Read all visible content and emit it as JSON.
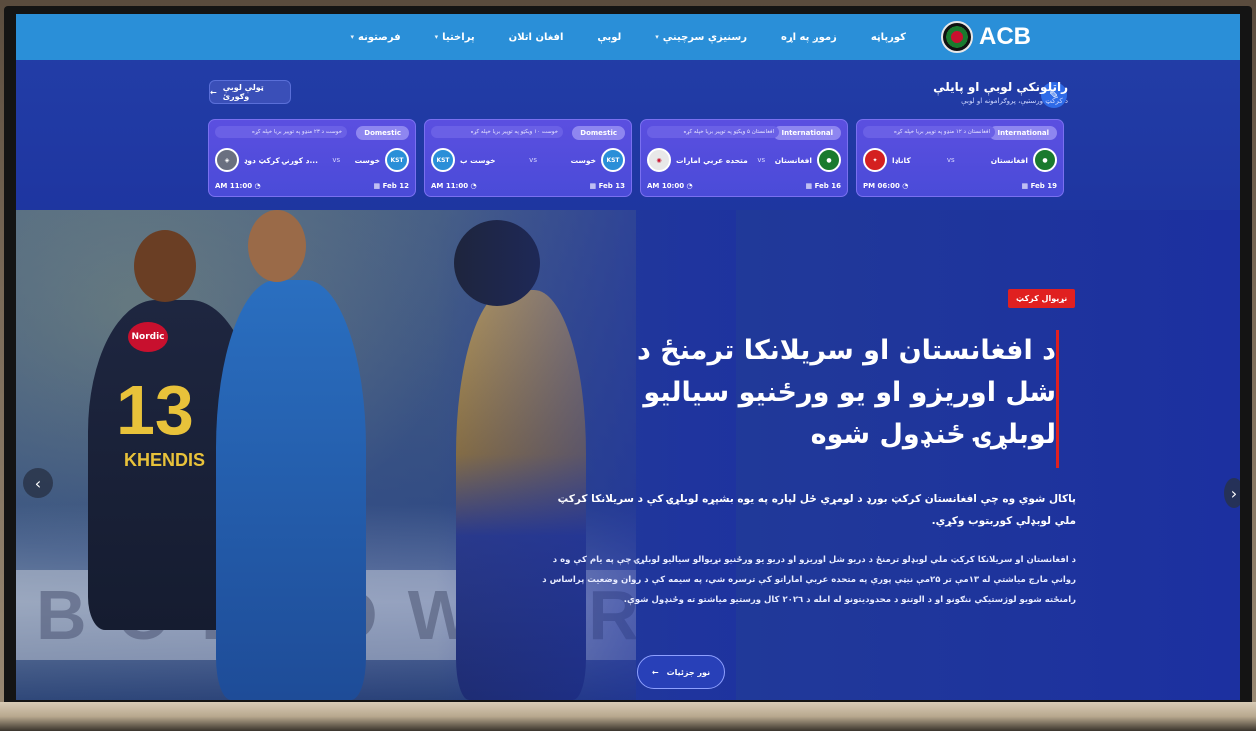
{
  "brand": {
    "name": "ACB"
  },
  "nav": {
    "items": [
      {
        "label": "کورپاڼه",
        "has_dropdown": false
      },
      {
        "label": "زموږ په اړه",
        "has_dropdown": false
      },
      {
        "label": "رسنیزې سرچینې",
        "has_dropdown": true
      },
      {
        "label": "لوبې",
        "has_dropdown": false
      },
      {
        "label": "افغان اتلان",
        "has_dropdown": false
      },
      {
        "label": "پراختیا",
        "has_dropdown": true
      },
      {
        "label": "فرصتونه",
        "has_dropdown": true
      }
    ]
  },
  "live": {
    "title": "راتلونکې لوبې او پایلې",
    "subtitle": "د کرکټ ورستیې، پروګرامونه او لوبې",
    "all_matches_label": "ټولې لوبې وګورئ"
  },
  "matches": [
    {
      "type": "International",
      "note": "افغانستان د ۱۲ منډو په توپیر بریا خپله کړه",
      "team_a": "افغانستان",
      "team_b": "کاناډا",
      "vs": "vs",
      "date": "Feb 19",
      "time": "PM 06:00",
      "team_a_color": "#1a7a2e",
      "team_b_color": "#d42020"
    },
    {
      "type": "International",
      "note": "افغانستان ۵ ویکټو په توپیر بریا خپله کړه",
      "team_a": "افغانستان",
      "team_b": "متحده عربي امارات",
      "vs": "vs",
      "date": "Feb 16",
      "time": "AM 10:00",
      "team_a_color": "#1a7a2e",
      "team_b_color": "#c8102e"
    },
    {
      "type": "Domestic",
      "note": "خوست ۱۰ ویکټو په توپیر بریا خپله کړه",
      "team_a": "خوست",
      "team_b": "خوست ب",
      "vs": "vs",
      "date": "Feb 13",
      "time": "AM 11:00",
      "team_a_color": "#2a8fd8",
      "team_b_color": "#2a8fd8"
    },
    {
      "type": "Domestic",
      "note": "خوست د ۲۳ منډو په توپیر بریا خپله کړه",
      "team_a": "خوست",
      "team_b": "د کورنۍ کرکټ دوډ...",
      "vs": "vs",
      "date": "Feb 12",
      "time": "AM 11:00",
      "team_a_color": "#2a8fd8",
      "team_b_color": "#6a7080"
    }
  ],
  "hero": {
    "badge": "نړیوال کرکټ",
    "headline": "د افغانستان او سریلانکا ترمنځ د شل اوریزو او یو ورځنیو سیالیو لوبلړۍ ځنډول شوه",
    "lead": "پاکال شوي وه چې افغانستان کرکټ بورډ د لومړي ځل لپاره په یوه بشپړه لوبلړۍ کې د سریلانکا کرکټ ملي لوبډلې کوربتوب وکړي.",
    "body": "د افغانستان او سریلانکا کرکټ ملي لوبډلو ترمنځ د دریو شل اوریزو او دریو یو ورځنیو نړیوالو سیالیو لوبلړۍ چې په یام کې وه د روانې مارچ میاشتې له ۱۳مې تر ۲۵مې نیټې پورې په متحده عربي اماراتو کې ترسره شي، په سیمه کې د روان وضعیت پراساس د رامنځته شویو لوژستیکي ننګونو او د الوتنو د محدودیتونو له امله د ۲۰۲٦ کال ورستیو میاشتو ته وځنډول شوې.",
    "details_label": "نور جزئیات",
    "board_text": "BOE DWORLD",
    "jersey_number": "13",
    "jersey_name": "KHENDIS",
    "jersey_sponsor": "Nordic"
  },
  "colors": {
    "nav_bg": "#2a8fd8",
    "accent_red": "#e02020",
    "card_bg": "#5b4fe0"
  }
}
